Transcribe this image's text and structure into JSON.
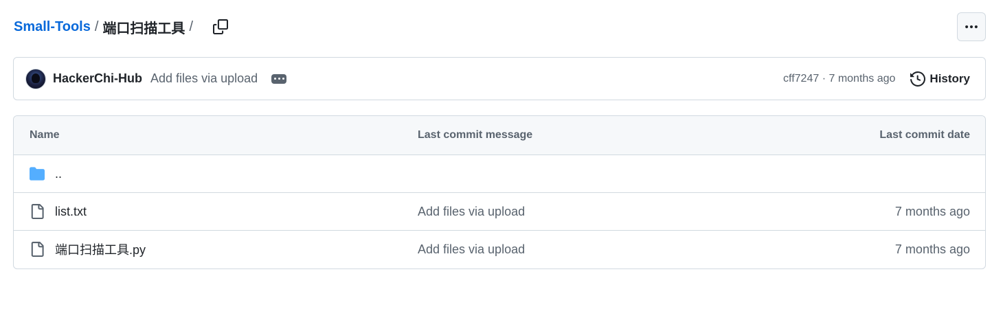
{
  "breadcrumb": {
    "repo": "Small-Tools",
    "separator": "/",
    "current": "端口扫描工具",
    "trailing_separator": "/"
  },
  "latest_commit": {
    "author": "HackerChi-Hub",
    "message": "Add files via upload",
    "sha": "cff7247",
    "meta_separator": " · ",
    "time": "7 months ago",
    "history_label": "History"
  },
  "table": {
    "columns": {
      "name": "Name",
      "message": "Last commit message",
      "date": "Last commit date"
    },
    "parent_dir": "..",
    "rows": [
      {
        "name": "list.txt",
        "icon": "file-icon",
        "message": "Add files via upload",
        "date": "7 months ago"
      },
      {
        "name": "端口扫描工具.py",
        "icon": "file-icon",
        "message": "Add files via upload",
        "date": "7 months ago"
      }
    ]
  },
  "colors": {
    "link": "#0969da",
    "folder": "#54aeff",
    "border": "#d1d9e0",
    "muted": "#59636e",
    "header_bg": "#f6f8fa"
  }
}
